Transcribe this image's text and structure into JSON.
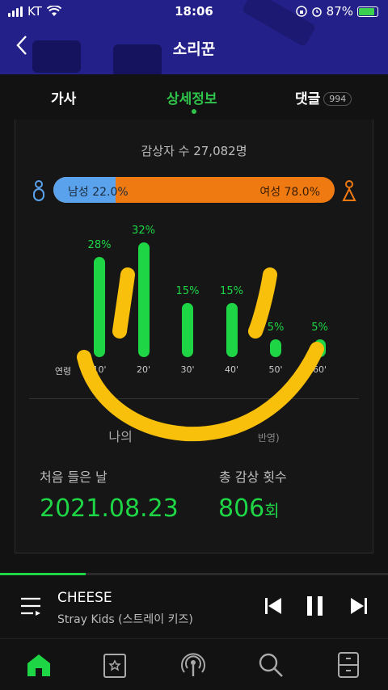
{
  "status_bar": {
    "carrier": "KT",
    "time": "18:06",
    "battery": "87%"
  },
  "header": {
    "title": "소리꾼"
  },
  "tabs": [
    {
      "label": "가사"
    },
    {
      "label": "상세정보"
    },
    {
      "label": "댓글",
      "badge": "994"
    }
  ],
  "stats": {
    "listeners": "감상자 수 27,082명",
    "male_label": "남성 22.0%",
    "female_label": "여성 78.0%",
    "male_share": 0.22
  },
  "chart_data": {
    "type": "bar",
    "xlabel": "연령",
    "categories": [
      "10'",
      "20'",
      "30'",
      "40'",
      "50'",
      "60'"
    ],
    "values": [
      28,
      32,
      15,
      15,
      5,
      5
    ],
    "labels": [
      "28%",
      "32%",
      "15%",
      "15%",
      "5%",
      "5%"
    ],
    "color": "#1ed545"
  },
  "my_stats": {
    "heading": "나의",
    "heading_note": "반영)",
    "first_listen_label": "처음 들은 날",
    "first_listen_value": "2021.08.23",
    "count_label": "총 감상 횟수",
    "count_value": "806",
    "count_unit": "회"
  },
  "player": {
    "song": "CHEESE",
    "artist": "Stray Kids (스트레이 키즈)",
    "progress": 0.22
  },
  "colors": {
    "accent": "#1ed545",
    "male": "#5aa2ec",
    "female": "#f07a12",
    "header_bg": "#23208a",
    "scribble": "#f8c00a"
  }
}
